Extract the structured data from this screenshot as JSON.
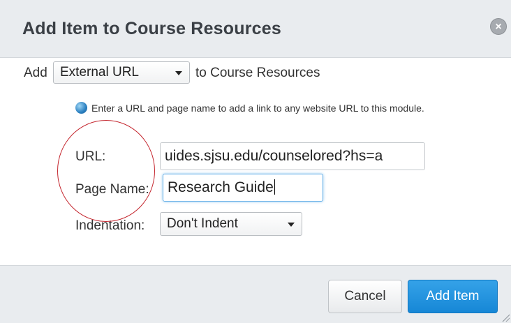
{
  "dialog": {
    "title": "Add Item to Course Resources",
    "close_icon": "close-icon"
  },
  "add_row": {
    "prefix": "Add",
    "type_value": "External URL",
    "suffix": "to Course Resources"
  },
  "hint": {
    "icon": "globe-icon",
    "text": "Enter a URL and page name to add a link to any website URL to this module."
  },
  "fields": {
    "url_label": "URL:",
    "url_value": "uides.sjsu.edu/counselored?hs=a",
    "page_name_label": "Page Name:",
    "page_name_value": "Research Guide",
    "indentation_label": "Indentation:",
    "indentation_value": "Don't Indent"
  },
  "footer": {
    "cancel_label": "Cancel",
    "add_item_label": "Add Item"
  },
  "colors": {
    "titlebar": "#e9ecef",
    "primary_button": "#1687d6",
    "annotation": "#c4262e"
  }
}
